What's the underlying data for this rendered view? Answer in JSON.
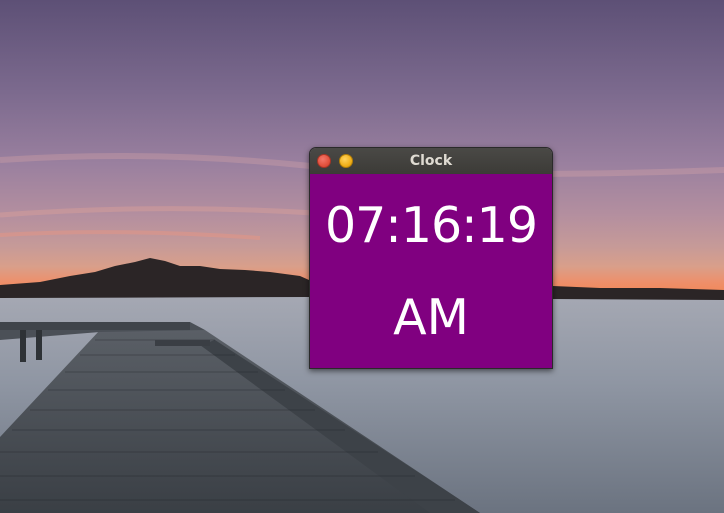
{
  "window": {
    "title": "Clock",
    "controls": {
      "close_icon": "close-icon",
      "minimize_icon": "minimize-icon"
    }
  },
  "clock": {
    "time": "07:16:19",
    "period": "AM",
    "background_color": "#800080",
    "text_color": "#ffffff"
  },
  "desktop": {
    "wallpaper": "lake-pier-sunset"
  }
}
